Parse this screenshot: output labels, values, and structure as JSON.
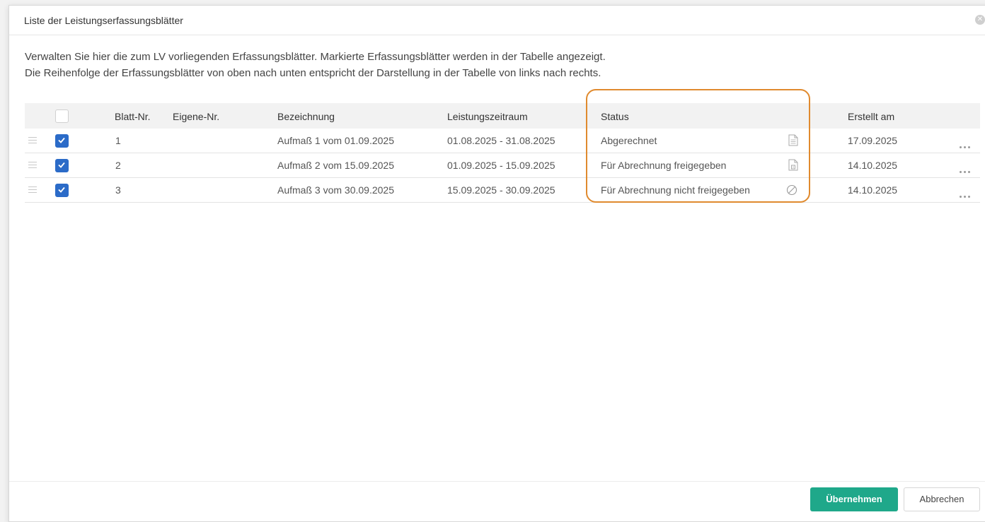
{
  "dialog": {
    "title": "Liste der Leistungserfassungsblätter",
    "description_line1": "Verwalten Sie hier die zum LV vorliegenden Erfassungsblätter. Markierte Erfassungsblätter werden in der Tabelle angezeigt.",
    "description_line2": "Die Reihenfolge der Erfassungsblätter von oben nach unten entspricht der Darstellung in der Tabelle von links nach rechts."
  },
  "table": {
    "columns": {
      "blatt_nr": "Blatt-Nr.",
      "eigene_nr": "Eigene-Nr.",
      "bezeichnung": "Bezeichnung",
      "leistungszeitraum": "Leistungszeitraum",
      "status": "Status",
      "erstellt_am": "Erstellt am"
    },
    "rows": [
      {
        "checked": true,
        "blatt_nr": "1",
        "eigene_nr": "",
        "bezeichnung": "Aufmaß 1 vom 01.09.2025",
        "leistungszeitraum": "01.08.2025 - 31.08.2025",
        "status": "Abgerechnet",
        "status_icon": "document-icon",
        "erstellt_am": "17.09.2025"
      },
      {
        "checked": true,
        "blatt_nr": "2",
        "eigene_nr": "",
        "bezeichnung": "Aufmaß 2 vom 15.09.2025",
        "leistungszeitraum": "01.09.2025 - 15.09.2025",
        "status": "Für Abrechnung freigegeben",
        "status_icon": "document-released-icon",
        "erstellt_am": "14.10.2025"
      },
      {
        "checked": true,
        "blatt_nr": "3",
        "eigene_nr": "",
        "bezeichnung": "Aufmaß 3 vom 30.09.2025",
        "leistungszeitraum": "15.09.2025 - 30.09.2025",
        "status": "Für Abrechnung nicht freigegeben",
        "status_icon": "not-allowed-icon",
        "erstellt_am": "14.10.2025"
      }
    ]
  },
  "footer": {
    "apply_label": "Übernehmen",
    "cancel_label": "Abbrechen"
  },
  "colors": {
    "accent": "#1fa88a",
    "checkbox": "#2b6bc8",
    "highlight": "#e08a2e"
  }
}
